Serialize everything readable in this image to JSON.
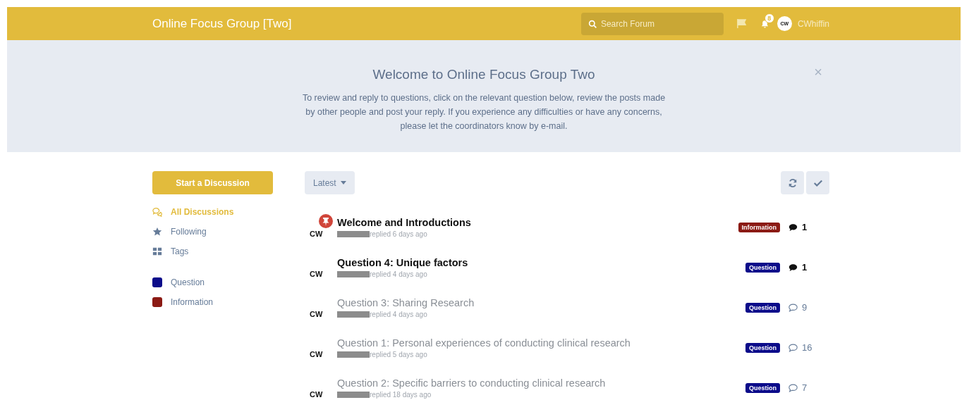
{
  "header": {
    "title": "Online Focus Group [Two]",
    "search": {
      "placeholder": "Search Forum"
    },
    "notifications": "8",
    "user": {
      "initials": "CW",
      "name": "CWhiffin"
    }
  },
  "hero": {
    "title": "Welcome to Online Focus Group Two",
    "text": "To review and reply to questions, click on the relevant question below, review the posts made by other people and post your reply. If you experience any difficulties or have any concerns, please let the coordinators know by e-mail.",
    "close": "×"
  },
  "start_button": "Start a Discussion",
  "nav": [
    {
      "label": "All Discussions",
      "kind": "chats",
      "selected": true
    },
    {
      "label": "Following",
      "kind": "star",
      "selected": false
    },
    {
      "label": "Tags",
      "kind": "grid",
      "selected": false
    }
  ],
  "tags": [
    {
      "label": "Question",
      "color": "#0b0b8a"
    },
    {
      "label": "Information",
      "color": "#8b1a14"
    }
  ],
  "sort": "Latest",
  "discussions": [
    {
      "author": "CW",
      "title": "Welcome and Introductions",
      "meta": "replied 6 days ago",
      "pinned": true,
      "unread": true,
      "tag": "Information",
      "color": "#8b1a14",
      "replies": "1"
    },
    {
      "author": "CW",
      "title": "Question 4: Unique factors",
      "meta": "replied 4 days ago",
      "pinned": false,
      "unread": true,
      "tag": "Question",
      "color": "#0b0b8a",
      "replies": "1"
    },
    {
      "author": "CW",
      "title": "Question 3: Sharing Research",
      "meta": "replied 4 days ago",
      "pinned": false,
      "unread": false,
      "tag": "Question",
      "color": "#0b0b8a",
      "replies": "9"
    },
    {
      "author": "CW",
      "title": "Question 1: Personal experiences of conducting clinical research",
      "meta": "replied 5 days ago",
      "pinned": false,
      "unread": false,
      "tag": "Question",
      "color": "#0b0b8a",
      "replies": "16"
    },
    {
      "author": "CW",
      "title": "Question 2: Specific barriers to conducting clinical research",
      "meta": "replied 18 days ago",
      "pinned": false,
      "unread": false,
      "tag": "Question",
      "color": "#0b0b8a",
      "replies": "7"
    }
  ]
}
